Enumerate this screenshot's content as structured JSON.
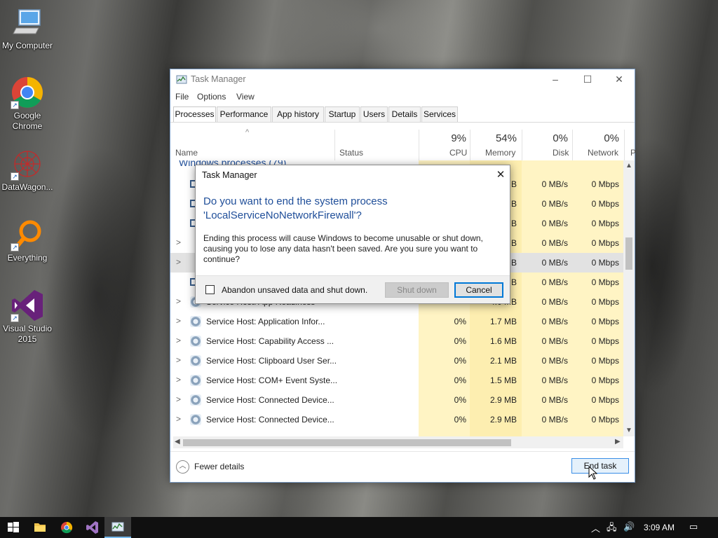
{
  "desktop": {
    "icons": [
      {
        "label": "My Computer"
      },
      {
        "label": "Google Chrome"
      },
      {
        "label": "DataWagon..."
      },
      {
        "label": "Everything"
      },
      {
        "label": "Visual Studio 2015"
      }
    ]
  },
  "taskmanager": {
    "title": "Task Manager",
    "menu": [
      "File",
      "Options",
      "View"
    ],
    "tabs": [
      "Processes",
      "Performance",
      "App history",
      "Startup",
      "Users",
      "Details",
      "Services"
    ],
    "active_tab": "Processes",
    "columns": {
      "name": "Name",
      "status": "Status",
      "cpu": {
        "pct": "9%",
        "label": "CPU"
      },
      "memory": {
        "pct": "54%",
        "label": "Memory"
      },
      "disk": {
        "pct": "0%",
        "label": "Disk"
      },
      "network": {
        "pct": "0%",
        "label": "Network"
      },
      "extra": "P"
    },
    "group_header": "Windows processes (79)",
    "hidden_rows": [
      {
        "mem_suffix": "B",
        "disk": "0 MB/s",
        "net": "0 Mbps"
      },
      {
        "mem_suffix": "B",
        "disk": "0 MB/s",
        "net": "0 Mbps"
      },
      {
        "mem_suffix": "B",
        "disk": "0 MB/s",
        "net": "0 Mbps"
      },
      {
        "mem_suffix": "B",
        "disk": "0 MB/s",
        "net": "0 Mbps"
      },
      {
        "mem_suffix": "B",
        "disk": "0 MB/s",
        "net": "0 Mbps"
      },
      {
        "mem_suffix": "B",
        "disk": "0 MB/s",
        "net": "0 Mbps"
      }
    ],
    "rows": [
      {
        "name": "Service Host: App Readiness",
        "cpu": "",
        "mem": "4.0 MB",
        "disk": "0 MB/s",
        "net": "0 Mbps"
      },
      {
        "name": "Service Host: Application Infor...",
        "cpu": "0%",
        "mem": "1.7 MB",
        "disk": "0 MB/s",
        "net": "0 Mbps"
      },
      {
        "name": "Service Host: Capability Access ...",
        "cpu": "0%",
        "mem": "1.6 MB",
        "disk": "0 MB/s",
        "net": "0 Mbps"
      },
      {
        "name": "Service Host: Clipboard User Ser...",
        "cpu": "0%",
        "mem": "2.1 MB",
        "disk": "0 MB/s",
        "net": "0 Mbps"
      },
      {
        "name": "Service Host: COM+ Event Syste...",
        "cpu": "0%",
        "mem": "1.5 MB",
        "disk": "0 MB/s",
        "net": "0 Mbps"
      },
      {
        "name": "Service Host: Connected Device...",
        "cpu": "0%",
        "mem": "2.9 MB",
        "disk": "0 MB/s",
        "net": "0 Mbps"
      },
      {
        "name": "Service Host: Connected Device...",
        "cpu": "0%",
        "mem": "2.9 MB",
        "disk": "0 MB/s",
        "net": "0 Mbps"
      }
    ],
    "fewer_details": "Fewer details",
    "end_task": "End task"
  },
  "dialog": {
    "title": "Task Manager",
    "heading_line1": "Do you want to end the system process",
    "heading_line2": "'LocalServiceNoNetworkFirewall'?",
    "body": "Ending this process will cause Windows to become unusable or shut down, causing you to lose any data hasn't been saved. Are you sure you want to continue?",
    "checkbox_label": "Abandon unsaved data and shut down.",
    "shutdown": "Shut down",
    "cancel": "Cancel"
  },
  "taskbar": {
    "time": "3:09 AM"
  },
  "colors": {
    "accent": "#0078d7",
    "heading_blue": "#1f4e99",
    "heat_cell": "#fff4c4"
  }
}
